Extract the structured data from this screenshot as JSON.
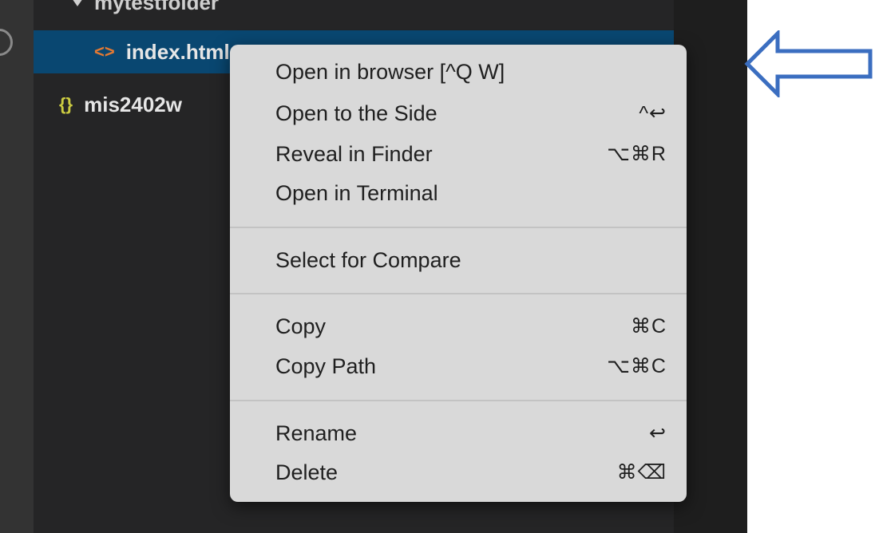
{
  "explorer": {
    "folder_label": "mytestfolder",
    "selected_file": "index.html",
    "html_icon": "<>",
    "json_file": "mis2402w",
    "json_icon": "{}"
  },
  "context_menu": {
    "items": [
      {
        "label": "Open in browser [^Q W]",
        "shortcut": ""
      },
      {
        "label": "Open to the Side",
        "shortcut": "^↩"
      },
      {
        "label": "Reveal in Finder",
        "shortcut": "⌥⌘R"
      },
      {
        "label": "Open in Terminal",
        "shortcut": ""
      },
      {
        "label": "Select for Compare",
        "shortcut": ""
      },
      {
        "label": "Copy",
        "shortcut": "⌘C"
      },
      {
        "label": "Copy Path",
        "shortcut": "⌥⌘C"
      },
      {
        "label": "Rename",
        "shortcut": "↩"
      },
      {
        "label": "Delete",
        "shortcut": "⌘⌫"
      }
    ]
  },
  "colors": {
    "selection": "#094771",
    "menu_background": "#d9d9d9",
    "arrow": "#3b6ec0",
    "html_icon": "#e37933",
    "json_icon": "#cbcb41"
  },
  "icons": [
    "html-file-icon",
    "json-file-icon",
    "left-arrow-icon"
  ]
}
